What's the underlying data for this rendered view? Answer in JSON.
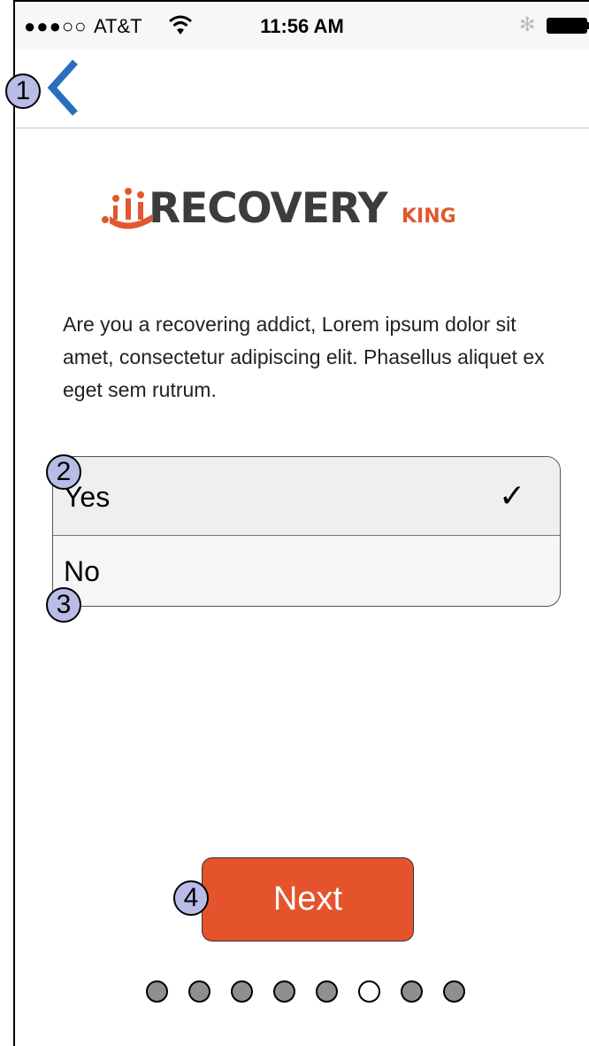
{
  "status_bar": {
    "signal": "●●●○○",
    "carrier": "AT&T",
    "wifi_icon": "wifi-icon",
    "time": "11:56 AM",
    "bluetooth": "✻",
    "battery_icon": "battery-icon"
  },
  "nav": {
    "back_icon": "chevron-left-icon",
    "accent_color": "#2a6ebd"
  },
  "logo": {
    "word": "RECOVERY",
    "suffix": "KING",
    "brand_color": "#e2572f"
  },
  "question": "Are you a recovering addict,  Lorem ipsum dolor sit amet, consectetur adipiscing elit. Phasellus aliquet ex eget sem rutrum.",
  "options": [
    {
      "label": "Yes",
      "selected": true,
      "check": "✓"
    },
    {
      "label": "No",
      "selected": false
    }
  ],
  "next_button": {
    "label": "Next",
    "color": "#e5532d"
  },
  "pagination": {
    "total": 8,
    "current": 6
  },
  "annotations": [
    "1",
    "2",
    "3",
    "4"
  ]
}
